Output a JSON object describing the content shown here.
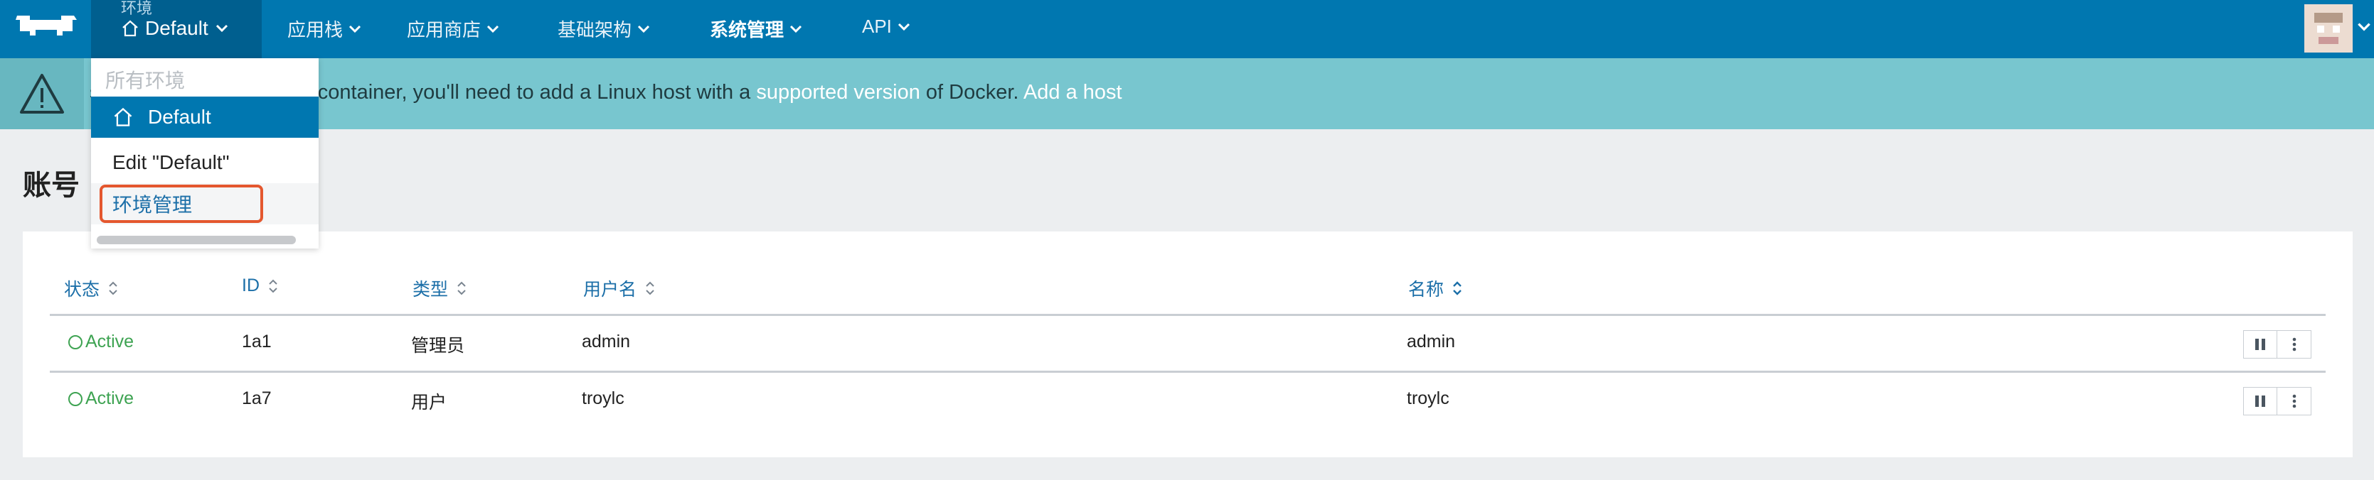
{
  "nav": {
    "env_label": "环境",
    "env_current": "Default",
    "items": [
      {
        "label": "应用栈"
      },
      {
        "label": "应用商店"
      },
      {
        "label": "基础架构"
      },
      {
        "label": "系统管理"
      },
      {
        "label": "API"
      }
    ]
  },
  "banner": {
    "text_pre": "st service or launching a container, you'll need to add a Linux host with a ",
    "link_supported": "supported version",
    "text_mid": " of Docker. ",
    "link_add_host": "Add a host"
  },
  "page": {
    "title": "账号"
  },
  "dropdown": {
    "header": "所有环境",
    "items": [
      {
        "label": "Default"
      },
      {
        "label": "Edit \"Default\""
      },
      {
        "label": "环境管理"
      }
    ]
  },
  "table": {
    "columns": [
      "状态",
      "ID",
      "类型",
      "用户名",
      "名称"
    ],
    "rows": [
      {
        "status": "Active",
        "id": "1a1",
        "type": "管理员",
        "username": "admin",
        "name": "admin"
      },
      {
        "status": "Active",
        "id": "1a7",
        "type": "用户",
        "username": "troylc",
        "name": "troylc"
      }
    ]
  },
  "colors": {
    "nav_bg": "#0077b0",
    "env_bg": "#005f8f",
    "banner_bg": "#78c6cf",
    "status_active": "#3ea352",
    "link": "#1c6fa8",
    "highlight_border": "#e4572e"
  },
  "icons": {
    "logo": "rancher-cow-logo-icon",
    "home": "home-icon",
    "chevron": "chevron-down-icon",
    "warning": "warning-triangle-icon",
    "sort": "sort-icon",
    "pause": "pause-icon",
    "more": "more-vertical-icon"
  }
}
